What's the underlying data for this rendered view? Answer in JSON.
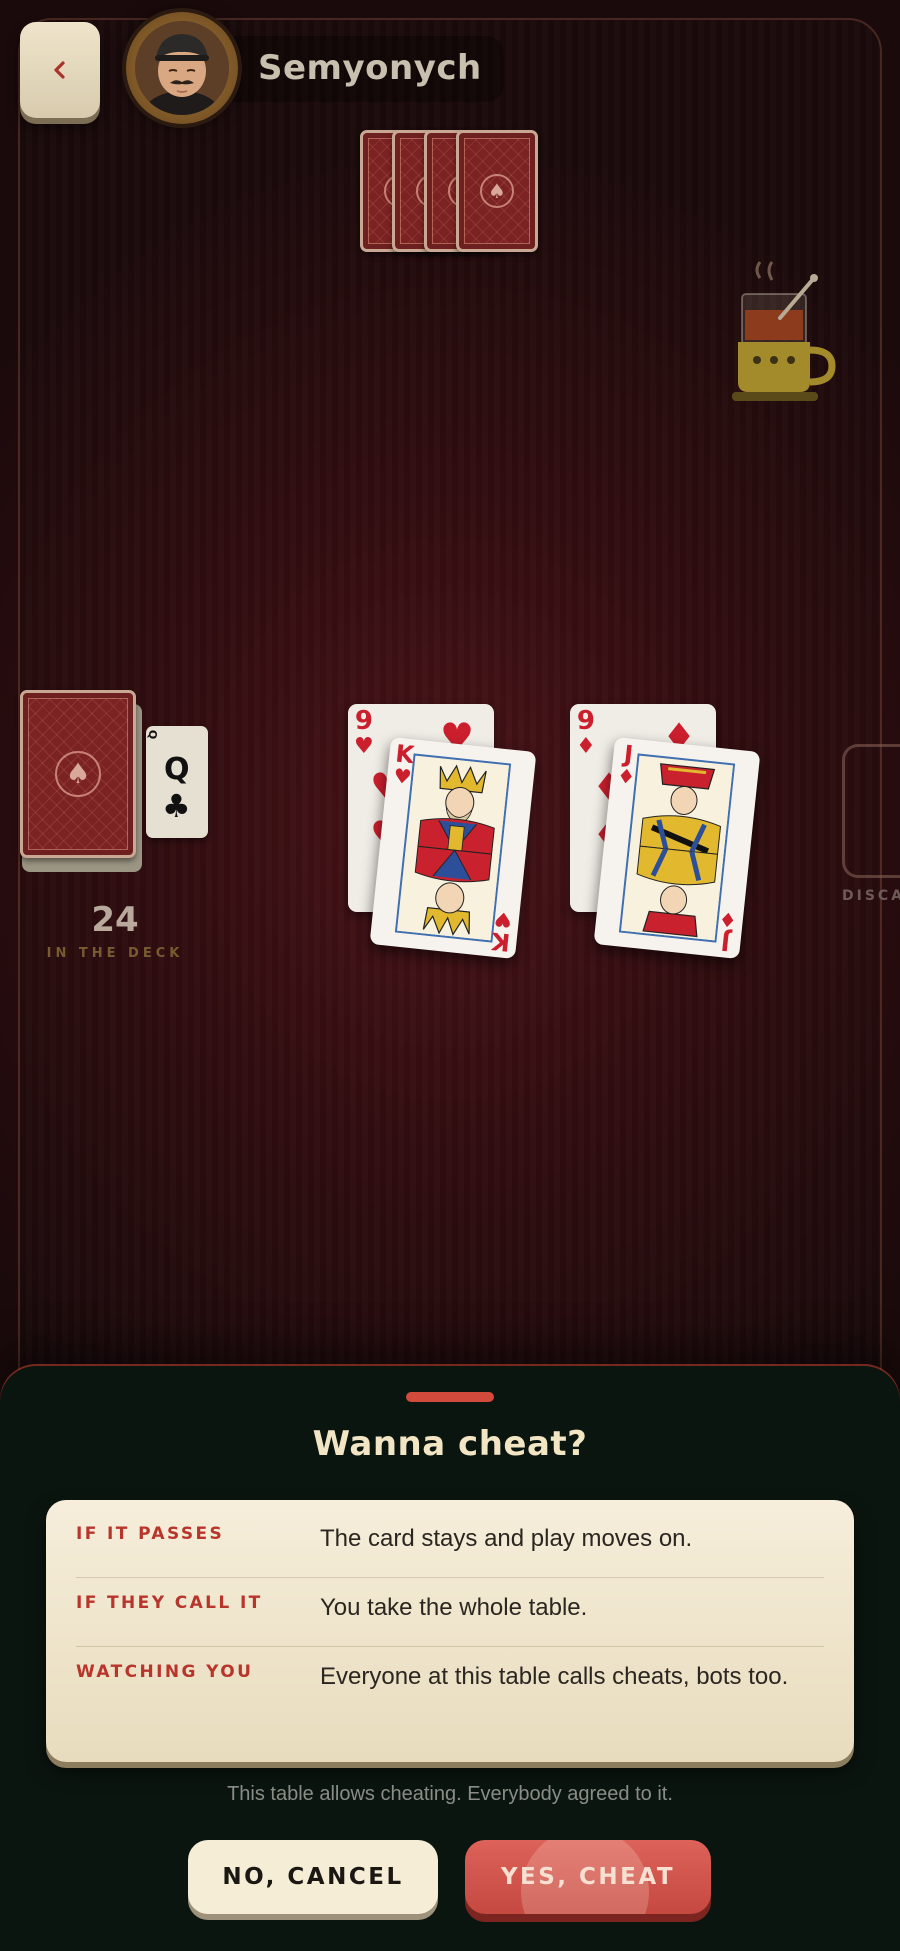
{
  "opponent": {
    "name": "Semyonych"
  },
  "deck": {
    "count": "24",
    "label": "IN THE DECK",
    "trump": {
      "rank": "Q",
      "suit": "♣"
    }
  },
  "played": [
    {
      "attack": {
        "rank": "9",
        "suit": "♥"
      },
      "defense": {
        "rank": "K",
        "suit": "♥"
      }
    },
    {
      "attack": {
        "rank": "9",
        "suit": "♦"
      },
      "defense": {
        "rank": "J",
        "suit": "♦"
      }
    }
  ],
  "discard": {
    "label": "DISCA"
  },
  "dialog": {
    "title": "Wanna cheat?",
    "rules": [
      {
        "key": "IF IT PASSES",
        "value": "The card stays and play moves on."
      },
      {
        "key": "IF THEY CALL IT",
        "value": "You take the whole table."
      },
      {
        "key": "WATCHING YOU",
        "value": "Everyone at this table calls cheats, bots too."
      }
    ],
    "note": "This table allows cheating. Everybody agreed to it.",
    "cancel_label": "NO, CANCEL",
    "confirm_label": "YES, CHEAT"
  },
  "colors": {
    "accent": "#c54940",
    "sheet": "#0b150f",
    "felt": "#4a1419",
    "panel": "#f6eedb"
  }
}
